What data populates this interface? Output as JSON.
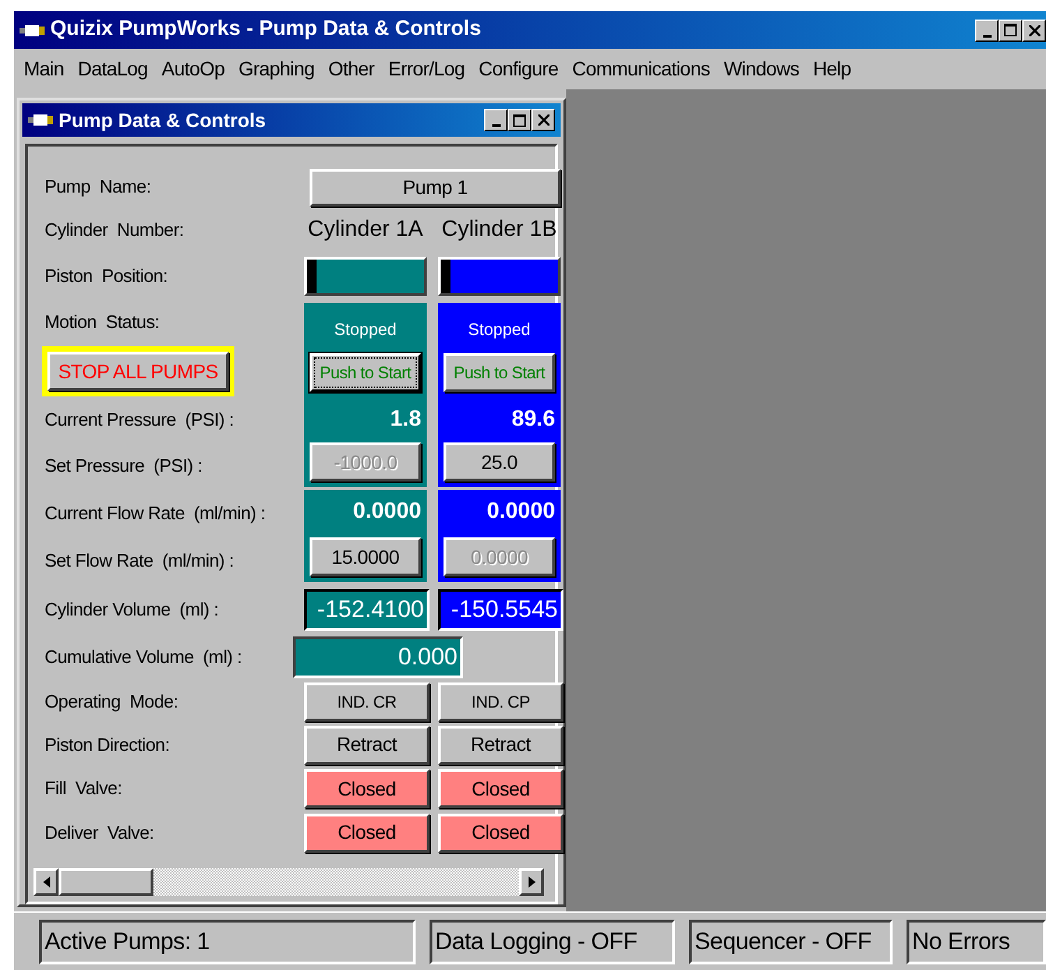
{
  "window": {
    "title": "Quizix PumpWorks - Pump Data & Controls"
  },
  "menu": [
    "Main",
    "DataLog",
    "AutoOp",
    "Graphing",
    "Other",
    "Error/Log",
    "Configure",
    "Communications",
    "Windows",
    "Help"
  ],
  "child_window": {
    "title": "Pump Data & Controls",
    "labels": {
      "pump_name": "Pump  Name:",
      "cylinder_number": "Cylinder  Number:",
      "piston_position": "Piston  Position:",
      "motion_status": "Motion  Status:",
      "current_pressure": "Current Pressure  (PSI) :",
      "set_pressure": "Set Pressure  (PSI) :",
      "current_flow": "Current Flow Rate  (ml/min) :",
      "set_flow": "Set Flow Rate  (ml/min) :",
      "cylinder_volume": "Cylinder Volume  (ml) :",
      "cumulative_volume": "Cumulative Volume  (ml) :",
      "operating_mode": "Operating  Mode:",
      "piston_direction": "Piston Direction:",
      "fill_valve": "Fill  Valve:",
      "deliver_valve": "Deliver  Valve:"
    },
    "pump_button": "Pump 1",
    "stop_button": "STOP ALL PUMPS",
    "cumulative_volume": "0.000",
    "cylinders": [
      {
        "name": "Cylinder 1A",
        "color": "#008080",
        "piston": {
          "level": 0.08
        },
        "motion_status": "Stopped",
        "start_button": {
          "label": "Push to Start",
          "focused": true
        },
        "current_pressure": "1.8",
        "set_pressure": {
          "value": "-1000.0",
          "disabled": true
        },
        "current_flow": "0.0000",
        "set_flow": {
          "value": "15.0000",
          "disabled": false
        },
        "volume": "-152.4100",
        "operating_mode": "IND. CR",
        "piston_direction": "Retract",
        "fill_valve": {
          "label": "Closed",
          "color": "#ff8080"
        },
        "deliver_valve": {
          "label": "Closed",
          "color": "#ff8080"
        }
      },
      {
        "name": "Cylinder 1B",
        "color": "#0000ff",
        "piston": {
          "level": 0.08
        },
        "motion_status": "Stopped",
        "start_button": {
          "label": "Push to Start",
          "focused": false
        },
        "current_pressure": "89.6",
        "set_pressure": {
          "value": "25.0",
          "disabled": false
        },
        "current_flow": "0.0000",
        "set_flow": {
          "value": "0.0000",
          "disabled": true
        },
        "volume": "-150.5545",
        "operating_mode": "IND. CP",
        "piston_direction": "Retract",
        "fill_valve": {
          "label": "Closed",
          "color": "#ff8080"
        },
        "deliver_valve": {
          "label": "Closed",
          "color": "#ff8080"
        }
      }
    ]
  },
  "status_bar": [
    "Active Pumps: 1",
    "Data Logging - OFF",
    "Sequencer - OFF",
    "No Errors"
  ]
}
